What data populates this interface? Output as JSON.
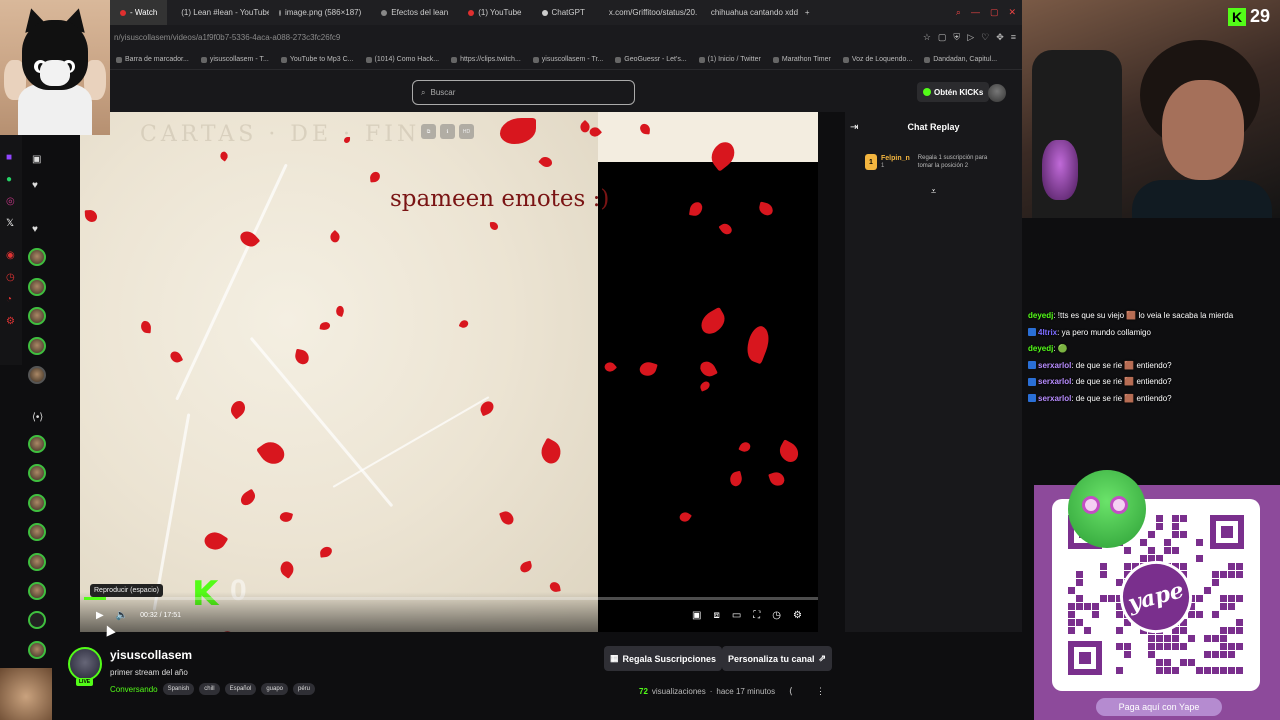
{
  "browser": {
    "tabs": [
      {
        "label": "- Watch",
        "active": true,
        "color": "#e02f2f"
      },
      {
        "label": "(1) Lean #lean - YouTube",
        "color": "#e02f2f"
      },
      {
        "label": "image.png (586×187)",
        "color": "#888888"
      },
      {
        "label": "Efectos del lean",
        "color": "#888888"
      },
      {
        "label": "(1) YouTube",
        "color": "#e02f2f"
      },
      {
        "label": "ChatGPT",
        "color": "#cccccc"
      },
      {
        "label": "x.com/Griffitoo/status/20...",
        "color": "#cccccc"
      },
      {
        "label": "chihuahua cantando xdd",
        "color": "#e02f2f"
      }
    ],
    "url": "n/yisuscollasem/videos/a1f9f0b7-5336-4aca-a088-273c3fc26fc9",
    "bookmarks": [
      "Barra de marcador...",
      "yisuscollasem - T...",
      "YouTube to Mp3 C...",
      "(1014) Como Hack...",
      "https://clips.twitch...",
      "yisuscollasem - Tr...",
      "GeoGuessr - Let's...",
      "(1) Inicio / Twitter",
      "Marathon Timer",
      "Voz de Loquendo...",
      "Dandadan, Capitul..."
    ]
  },
  "header": {
    "search_placeholder": "Buscar",
    "obtain_kicks": "Obtén KICKs"
  },
  "video": {
    "overlay_text": "spameen emotes :)",
    "tooltip": "Reproducir (espacio)",
    "time": "00:32 / 17:51",
    "progress": 0.03,
    "kick_zero": "0"
  },
  "chat_panel": {
    "title": "Chat Replay",
    "sub_user": "Felpin_n",
    "sub_count": "1",
    "sub_rank": "1",
    "sub_text": "Regala 1 suscripción para tomar la posición 2"
  },
  "stream": {
    "channel": "yisuscollasem",
    "title": "primer stream del año",
    "category": "Conversando",
    "tags": [
      "Spanish",
      "chill",
      "Español",
      "guapo",
      "péru"
    ],
    "gift_button": "Regala Suscripciones",
    "customize_button": "Personaliza tu canal",
    "view_count": "72",
    "views_label": "visualizaciones",
    "time_ago": "hace 17 minutos",
    "live": "LIVE"
  },
  "overlay_chat": [
    {
      "user": "deyedj",
      "color": "#53fc18",
      "text": ": !tts es que su viejo 🟫 lo veia le sacaba la mierda"
    },
    {
      "user": "4ltrix",
      "color": "#7b6cff",
      "text": ": ya pero mundo collamigo"
    },
    {
      "user": "deyedj",
      "color": "#53fc18",
      "text": ": 🟢"
    },
    {
      "user": "serxarlol",
      "color": "#b88cff",
      "text": ": de que se rie 🟫 entiendo?"
    },
    {
      "user": "serxarlol",
      "color": "#b88cff",
      "text": ": de que se rie 🟫 entiendo?"
    },
    {
      "user": "serxarlol",
      "color": "#b88cff",
      "text": ": de que se rie 🟫 entiendo?"
    }
  ],
  "webcam": {
    "k_count": "29"
  },
  "qr": {
    "brand": "yape",
    "pay_text": "Paga aquí con Yape"
  },
  "colors": {
    "kick_green": "#53fc18",
    "petal_red": "#d8161e",
    "yape_purple": "#7a2f8d"
  }
}
